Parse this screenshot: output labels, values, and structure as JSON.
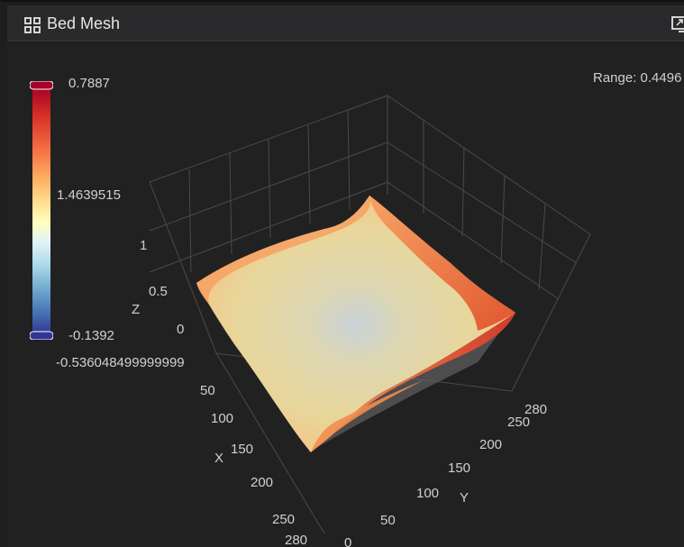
{
  "header": {
    "title": "Bed Mesh",
    "title_icon": "grid-icon",
    "action_icon": "window-toggle-icon"
  },
  "stats": {
    "range_text": "Range: 0.4496"
  },
  "colorscale": {
    "max_label": "0.7887",
    "mid_label": "1.4639515",
    "min_label": "-0.1392",
    "colors": [
      "#a50026",
      "#d73027",
      "#f46d43",
      "#fdae61",
      "#fee090",
      "#ffffbf",
      "#e0f3f8",
      "#abd9e9",
      "#74add1",
      "#4575b4",
      "#313695"
    ]
  },
  "axes": {
    "z_title": "Z",
    "x_title": "X",
    "y_title": "Y",
    "z_ticks": [
      "1",
      "0.5",
      "0",
      "-0.536048499999999"
    ],
    "x_ticks": [
      "50",
      "100",
      "150",
      "200",
      "250",
      "280"
    ],
    "y_ticks": [
      "50",
      "100",
      "150",
      "200",
      "250",
      "280"
    ],
    "x_last_partial": "0"
  }
}
